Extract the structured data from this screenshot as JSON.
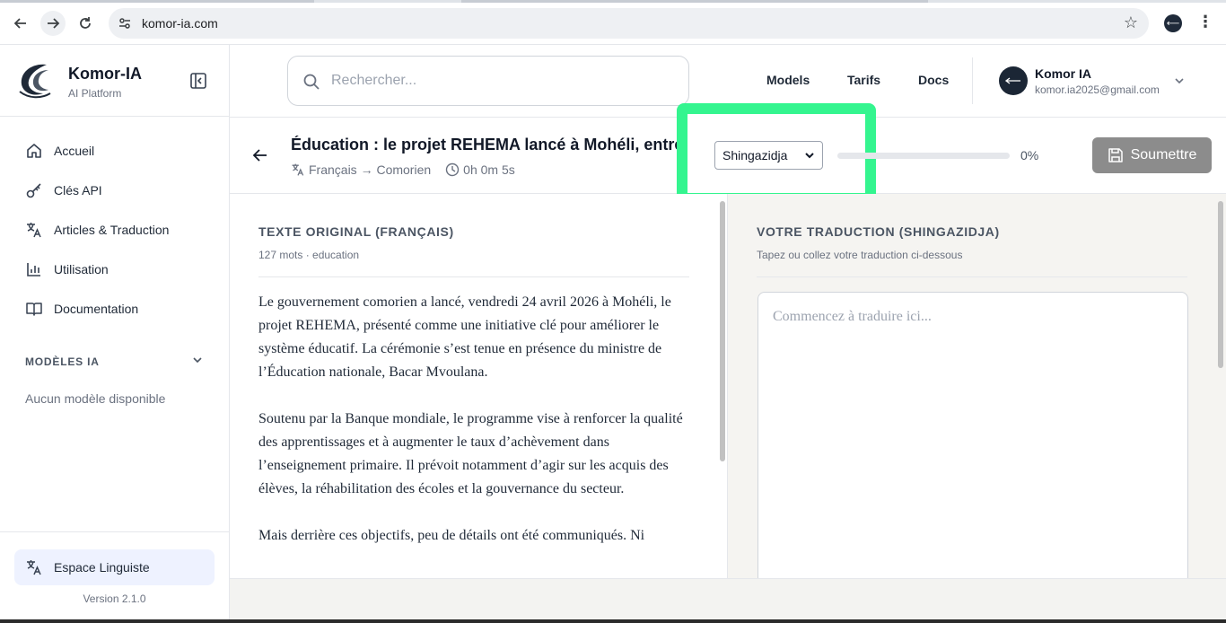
{
  "browser": {
    "url": "komor-ia.com",
    "profile_initial": "⟵"
  },
  "sidebar": {
    "brand_name": "Komor-IA",
    "brand_sub": "AI Platform",
    "items": [
      {
        "label": "Accueil",
        "icon": "home-icon"
      },
      {
        "label": "Clés API",
        "icon": "key-icon"
      },
      {
        "label": "Articles & Traduction",
        "icon": "translate-icon"
      },
      {
        "label": "Utilisation",
        "icon": "bar-chart-icon"
      },
      {
        "label": "Documentation",
        "icon": "book-icon"
      }
    ],
    "models_header": "MODÈLES IA",
    "no_models": "Aucun modèle disponible",
    "linguist_label": "Espace Linguiste",
    "version": "Version 2.1.0"
  },
  "header": {
    "search_placeholder": "Rechercher...",
    "nav": [
      "Models",
      "Tarifs",
      "Docs"
    ],
    "user_name": "Komor IA",
    "user_email": "komor.ia2025@gmail.com"
  },
  "doc": {
    "title": "Éducation : le projet REHEMA lancé à Mohéli, entre",
    "lang_pair": "Français → Comorien",
    "duration": "0h 0m 5s",
    "target_lang": "Shingazidja",
    "progress_fraction": 0,
    "progress_label": "0%",
    "submit_label": "Soumettre"
  },
  "left_panel": {
    "title": "TEXTE ORIGINAL (FRANÇAIS)",
    "subtitle": "127 mots · education",
    "paragraphs": [
      "Le gouvernement comorien a lancé, vendredi 24 avril 2026 à Mohéli, le projet REHEMA, présenté comme une initiative clé pour améliorer le système éducatif. La cérémonie s’est tenue en présence du ministre de l’Éducation nationale, Bacar Mvoulana.",
      "Soutenu par la Banque mondiale, le programme vise à renforcer la qualité des apprentissages et à augmenter le taux d’achèvement dans l’enseignement primaire. Il prévoit notamment d’agir sur les acquis des élèves, la réhabilitation des écoles et la gouvernance du secteur.",
      "Mais derrière ces objectifs, peu de détails ont été communiqués. Ni"
    ]
  },
  "right_panel": {
    "title": "VOTRE TRADUCTION (SHINGAZIDJA)",
    "subtitle": "Tapez ou collez votre traduction ci-dessous",
    "placeholder": "Commencez à traduire ici..."
  },
  "colors": {
    "highlight": "#34f58f",
    "submit_bg": "#8c8c8c",
    "linguist_bg": "#eef2ff"
  }
}
